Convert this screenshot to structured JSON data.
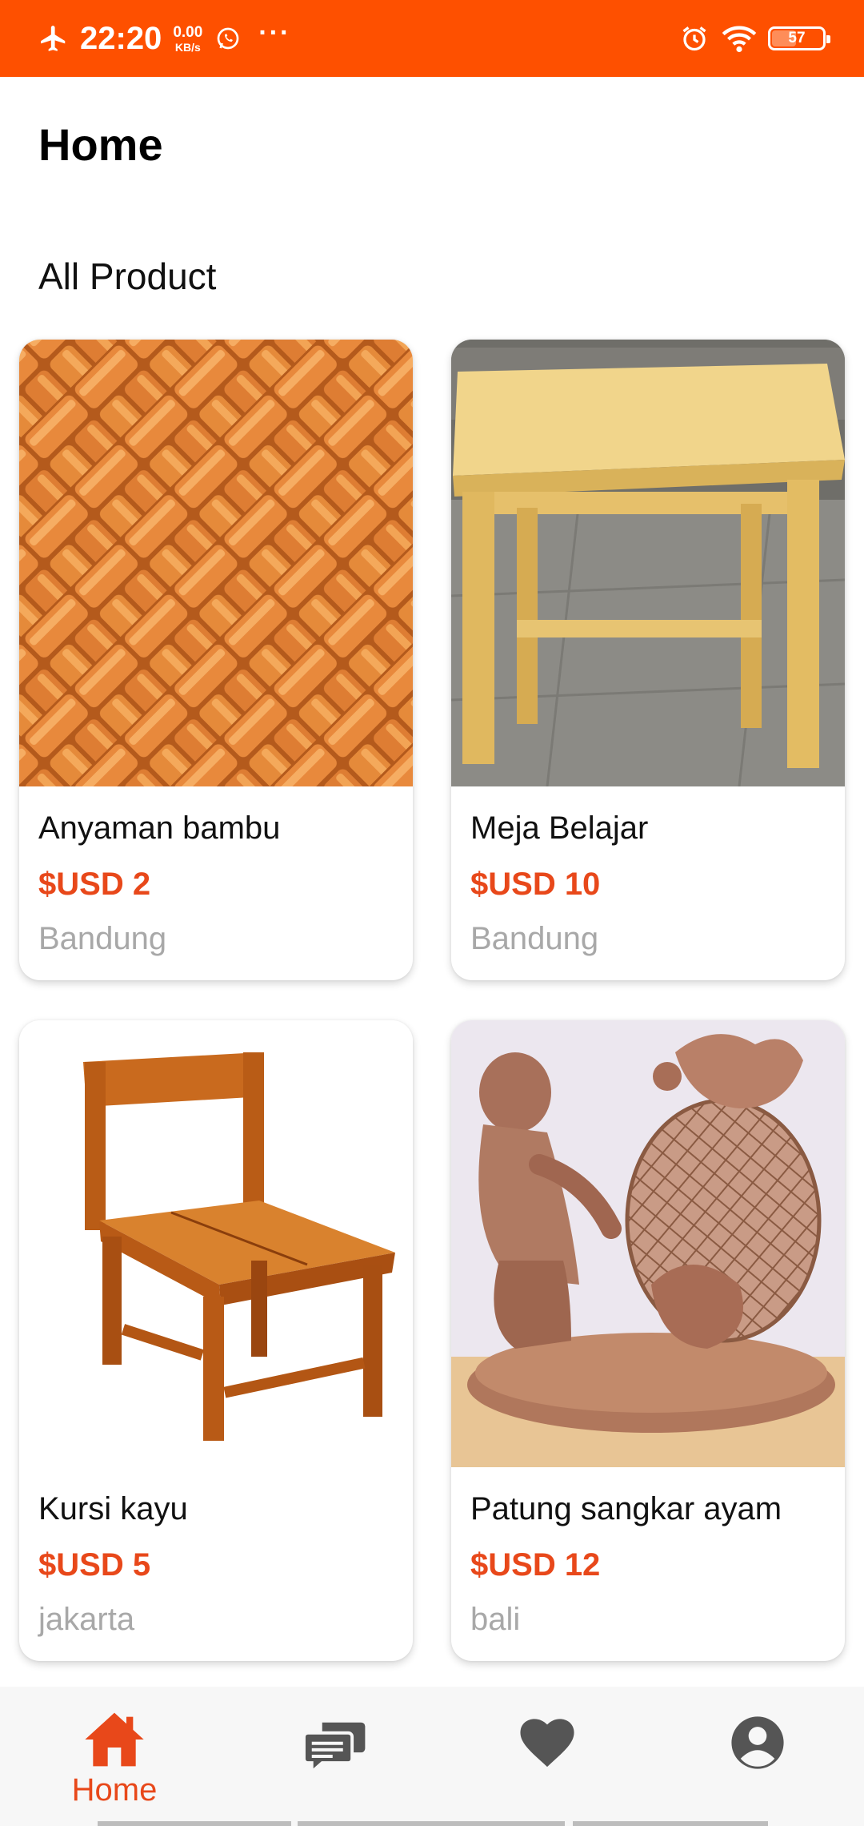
{
  "status_bar": {
    "time": "22:20",
    "net_speed_value": "0.00",
    "net_speed_unit": "KB/s",
    "more": "···",
    "battery": "57",
    "icons": [
      "airplane-icon",
      "whatsapp-icon",
      "alarm-icon",
      "wifi-icon",
      "battery-icon"
    ]
  },
  "header": {
    "title": "Home"
  },
  "section": {
    "title": "All Product"
  },
  "products": [
    {
      "name": "Anyaman bambu",
      "price": "$USD 2",
      "location": "Bandung",
      "image": "woven-bamboo-image"
    },
    {
      "name": "Meja Belajar",
      "price": "$USD 10",
      "location": "Bandung",
      "image": "wooden-table-image"
    },
    {
      "name": "Kursi kayu",
      "price": "$USD 5",
      "location": "jakarta",
      "image": "wooden-chair-image"
    },
    {
      "name": "Patung sangkar ayam",
      "price": "$USD 12",
      "location": "bali",
      "image": "carved-statue-image"
    }
  ],
  "bottom_nav": {
    "items": [
      {
        "label": "Home",
        "icon": "home-icon",
        "active": true
      },
      {
        "label": "",
        "icon": "chat-icon",
        "active": false
      },
      {
        "label": "",
        "icon": "heart-icon",
        "active": false
      },
      {
        "label": "",
        "icon": "account-icon",
        "active": false
      }
    ]
  },
  "colors": {
    "accent": "#fe5000",
    "price": "#e8481a",
    "location": "#a8a8a8",
    "nav_inactive": "#555555"
  }
}
